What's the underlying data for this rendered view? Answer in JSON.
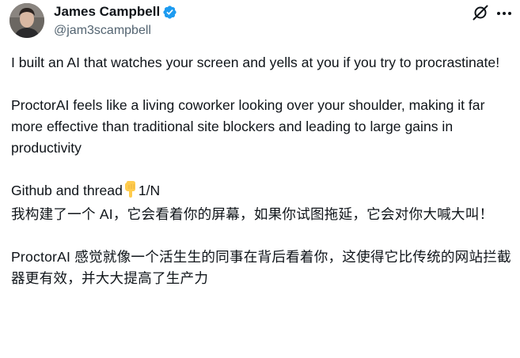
{
  "author": {
    "name": "James Campbell",
    "handle": "@jam3scampbell",
    "verified": true,
    "avatar_icon": "avatar-photo"
  },
  "header_actions": {
    "grok_icon": "grok-icon",
    "more_icon": "more-horizontal-icon"
  },
  "body": {
    "p1": "I built an AI that watches your screen and yells at you if you try to procrastinate!",
    "p2": "ProctorAI feels like a living coworker looking over your shoulder, making it far more effective than traditional site blockers and leading to large gains in productivity",
    "p3_prefix": "Github and thread",
    "p3_emoji": "👇",
    "p3_suffix": "1/N",
    "p4_cn": "我构建了一个 AI，它会看着你的屏幕，如果你试图拖延，它会对你大喊大叫！",
    "p5_cn": "ProctorAI 感觉就像一个活生生的同事在背后看着你，这使得它比传统的网站拦截器更有效，并大大提高了生产力"
  },
  "colors": {
    "text": "#0f1419",
    "secondary": "#536471",
    "verified": "#1d9bf0",
    "emoji": "#ffcc4d"
  }
}
